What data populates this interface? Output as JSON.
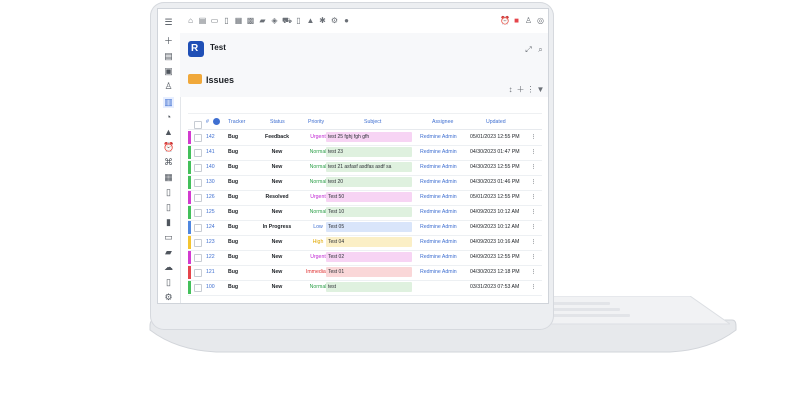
{
  "sidebar": {
    "icons": [
      "menu-icon",
      "plus-icon",
      "home-icon",
      "clipboard-icon",
      "person-icon",
      "list-icon",
      "pie-icon",
      "chart-icon",
      "alarm-icon",
      "tree-icon",
      "board-icon",
      "doc-icon",
      "doc2-icon",
      "book-icon",
      "bus-icon",
      "briefcase-icon",
      "cloud-icon",
      "file-icon",
      "gear-icon"
    ]
  },
  "topbar": {
    "icons": [
      "home-icon",
      "doc-icon",
      "folder-icon",
      "doc2-icon",
      "calendar-icon",
      "grid-icon",
      "briefcase-icon",
      "tag-icon",
      "cart-icon",
      "doc3-icon",
      "chart-icon",
      "settings-icon",
      "settings2-icon",
      "info-icon"
    ],
    "right_icons": [
      "bell-icon",
      "notification-icon",
      "user-icon",
      "help-icon"
    ]
  },
  "project": {
    "title": "Test"
  },
  "issues": {
    "title": "Issues"
  },
  "table": {
    "headers": {
      "id": "#",
      "tracker": "Tracker",
      "status": "Status",
      "priority": "Priority",
      "subject": "Subject",
      "assignee": "Assignee",
      "updated": "Updated"
    },
    "rows": [
      {
        "id": "142",
        "tracker": "Bug",
        "status": "Feedback",
        "priority": "Urgent",
        "subject": "test 25 fghj fgh gfh",
        "assignee": "Redmine Admin",
        "updated": "05/01/2023 12:55 PM",
        "bar": "#d23bd0",
        "prio_color": "#c026d3",
        "subject_bg": "#f7d4f4"
      },
      {
        "id": "141",
        "tracker": "Bug",
        "status": "New",
        "priority": "Normal",
        "subject": "test 23",
        "assignee": "Redmine Admin",
        "updated": "04/30/2023 01:47 PM",
        "bar": "#44c05b",
        "prio_color": "#2ea04a",
        "subject_bg": "#dff1df"
      },
      {
        "id": "140",
        "tracker": "Bug",
        "status": "New",
        "priority": "Normal",
        "subject": "test 21 asfasf asdfas asdf sa",
        "assignee": "Redmine Admin",
        "updated": "04/30/2023 12:55 PM",
        "bar": "#44c05b",
        "prio_color": "#2ea04a",
        "subject_bg": "#dff1df"
      },
      {
        "id": "130",
        "tracker": "Bug",
        "status": "New",
        "priority": "Normal",
        "subject": "test 20",
        "assignee": "Redmine Admin",
        "updated": "04/30/2023 01:46 PM",
        "bar": "#44c05b",
        "prio_color": "#2ea04a",
        "subject_bg": "#dff1df"
      },
      {
        "id": "126",
        "tracker": "Bug",
        "status": "Resolved",
        "priority": "Urgent",
        "subject": "Test 50",
        "assignee": "Redmine Admin",
        "updated": "05/01/2023 12:55 PM",
        "bar": "#d23bd0",
        "prio_color": "#c026d3",
        "subject_bg": "#f7d4f4"
      },
      {
        "id": "125",
        "tracker": "Bug",
        "status": "New",
        "priority": "Normal",
        "subject": "Test 10",
        "assignee": "Redmine Admin",
        "updated": "04/09/2023 10:12 AM",
        "bar": "#44c05b",
        "prio_color": "#2ea04a",
        "subject_bg": "#dff1df"
      },
      {
        "id": "124",
        "tracker": "Bug",
        "status": "In Progress",
        "priority": "Low",
        "subject": "Test 05",
        "assignee": "Redmine Admin",
        "updated": "04/09/2023 10:12 AM",
        "bar": "#4f87e0",
        "prio_color": "#3f6fd1",
        "subject_bg": "#d9e5fa"
      },
      {
        "id": "123",
        "tracker": "Bug",
        "status": "New",
        "priority": "High",
        "subject": "Test 04",
        "assignee": "Redmine Admin",
        "updated": "04/09/2023 10:16 AM",
        "bar": "#f3c431",
        "prio_color": "#e0a800",
        "subject_bg": "#fbefc6"
      },
      {
        "id": "122",
        "tracker": "Bug",
        "status": "New",
        "priority": "Urgent",
        "subject": "Test 02",
        "assignee": "Redmine Admin",
        "updated": "04/09/2023 12:55 PM",
        "bar": "#d23bd0",
        "prio_color": "#c026d3",
        "subject_bg": "#f7d4f4"
      },
      {
        "id": "121",
        "tracker": "Bug",
        "status": "New",
        "priority": "Immediate",
        "subject": "Test 01",
        "assignee": "Redmine Admin",
        "updated": "04/30/2023 12:18 PM",
        "bar": "#e5454b",
        "prio_color": "#e03131",
        "subject_bg": "#fad7d8"
      },
      {
        "id": "100",
        "tracker": "Bug",
        "status": "New",
        "priority": "Normal",
        "subject": "test",
        "assignee": "",
        "updated": "03/31/2023 07:53 AM",
        "bar": "#44c05b",
        "prio_color": "#2ea04a",
        "subject_bg": "#dff1df"
      }
    ]
  }
}
